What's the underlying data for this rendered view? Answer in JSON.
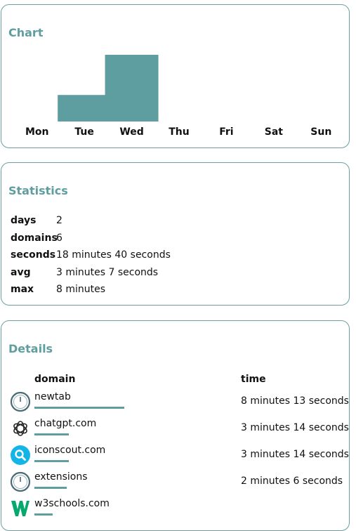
{
  "chart_card": {
    "title": "Chart"
  },
  "chart_data": {
    "type": "bar",
    "title": "Chart",
    "categories": [
      "Mon",
      "Tue",
      "Wed",
      "Thu",
      "Fri",
      "Sat",
      "Sun"
    ],
    "values": [
      0,
      3.5,
      8.8,
      0,
      0,
      0,
      0
    ],
    "ylim": [
      0,
      8.8
    ],
    "bar_color": "#5f9ea0",
    "grid": false
  },
  "stats": {
    "title": "Statistics",
    "rows": [
      {
        "key": "days",
        "value": "2"
      },
      {
        "key": "domains",
        "value": "6"
      },
      {
        "key": "seconds",
        "value": "18 minutes 40 seconds"
      },
      {
        "key": "avg",
        "value": "3 minutes 7 seconds"
      },
      {
        "key": "max",
        "value": "8 minutes"
      }
    ]
  },
  "details": {
    "title": "Details",
    "col_domain": "domain",
    "col_time": "time",
    "rows": [
      {
        "domain": "newtab",
        "time": "8 minutes 13 seconds",
        "icon": "clock-icon",
        "share": 1.0
      },
      {
        "domain": "chatgpt.com",
        "time": "3 minutes 14 seconds",
        "icon": "openai-logo-icon",
        "share": 0.38
      },
      {
        "domain": "iconscout.com",
        "time": "3 minutes 14 seconds",
        "icon": "search-magnifier-icon",
        "share": 0.38
      },
      {
        "domain": "extensions",
        "time": "2 minutes 6 seconds",
        "icon": "clock-icon",
        "share": 0.36
      },
      {
        "domain": "w3schools.com",
        "time": "",
        "icon": "w3schools-logo-icon",
        "share": 0.2
      }
    ]
  }
}
